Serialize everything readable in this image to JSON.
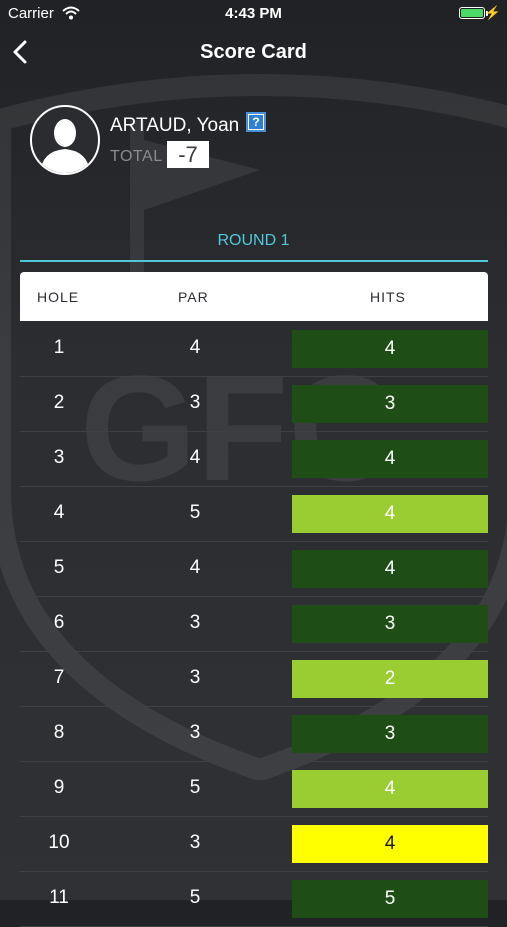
{
  "status_bar": {
    "carrier": "Carrier",
    "time": "4:43 PM"
  },
  "nav": {
    "title": "Score Card"
  },
  "player": {
    "name": "ARTAUD, Yoan",
    "help": "?",
    "total_label": "TOTAL",
    "total_value": "-7"
  },
  "round": {
    "label": "ROUND 1"
  },
  "table": {
    "headers": {
      "hole": "HOLE",
      "par": "PAR",
      "hits": "HITS"
    },
    "rows": [
      {
        "hole": "1",
        "par": "4",
        "hits": "4"
      },
      {
        "hole": "2",
        "par": "3",
        "hits": "3"
      },
      {
        "hole": "3",
        "par": "4",
        "hits": "4"
      },
      {
        "hole": "4",
        "par": "5",
        "hits": "4"
      },
      {
        "hole": "5",
        "par": "4",
        "hits": "4"
      },
      {
        "hole": "6",
        "par": "3",
        "hits": "3"
      },
      {
        "hole": "7",
        "par": "3",
        "hits": "2"
      },
      {
        "hole": "8",
        "par": "3",
        "hits": "3"
      },
      {
        "hole": "9",
        "par": "5",
        "hits": "4"
      },
      {
        "hole": "10",
        "par": "3",
        "hits": "4"
      },
      {
        "hole": "11",
        "par": "5",
        "hits": "5"
      }
    ]
  },
  "colors": {
    "par": "#1e4d15",
    "birdie": "#9acd32",
    "bogey": "#ffff00",
    "accent": "#4fc8d8",
    "battery": "#4cd964"
  }
}
